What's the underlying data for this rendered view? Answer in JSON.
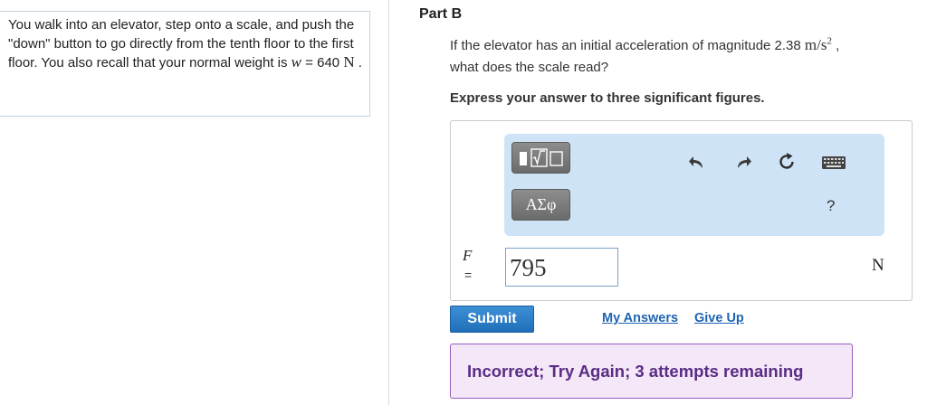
{
  "problem": {
    "text_1": "You walk into an elevator, step onto a scale, and push the \"down\" button to go directly from the tenth floor to the first floor. You also recall that your normal weight is ",
    "weight_var": "w",
    "weight_eq": " = 640 ",
    "weight_unit": "N",
    "text_end": " ."
  },
  "part": {
    "title": "Part B"
  },
  "question": {
    "text_1": "If the elevator has an initial acceleration of magnitude 2.38 ",
    "unit_base": "m/s",
    "unit_exp": "2",
    "text_2": " ,",
    "text_3": "what does the scale read?"
  },
  "instruction": "Express your answer to three significant figures.",
  "toolbar": {
    "greek_label": "ΑΣφ",
    "help_label": "?",
    "icons": [
      "templates-icon",
      "undo-icon",
      "redo-icon",
      "reset-icon",
      "keyboard-icon"
    ]
  },
  "answer": {
    "variable": "F",
    "equals": "=",
    "value": "795",
    "unit": "N"
  },
  "actions": {
    "submit_label": "Submit",
    "my_answers_label": "My Answers",
    "give_up_label": "Give Up"
  },
  "feedback": {
    "text": "Incorrect; Try Again; 3 attempts remaining",
    "bg_color": "#f3e7f8",
    "border_color": "#9a5bbd",
    "text_color": "#5a2c83"
  },
  "colors": {
    "link": "#1f64b2",
    "submit": "#2a7cc7",
    "toolbar_bg": "#cfe3f6"
  }
}
